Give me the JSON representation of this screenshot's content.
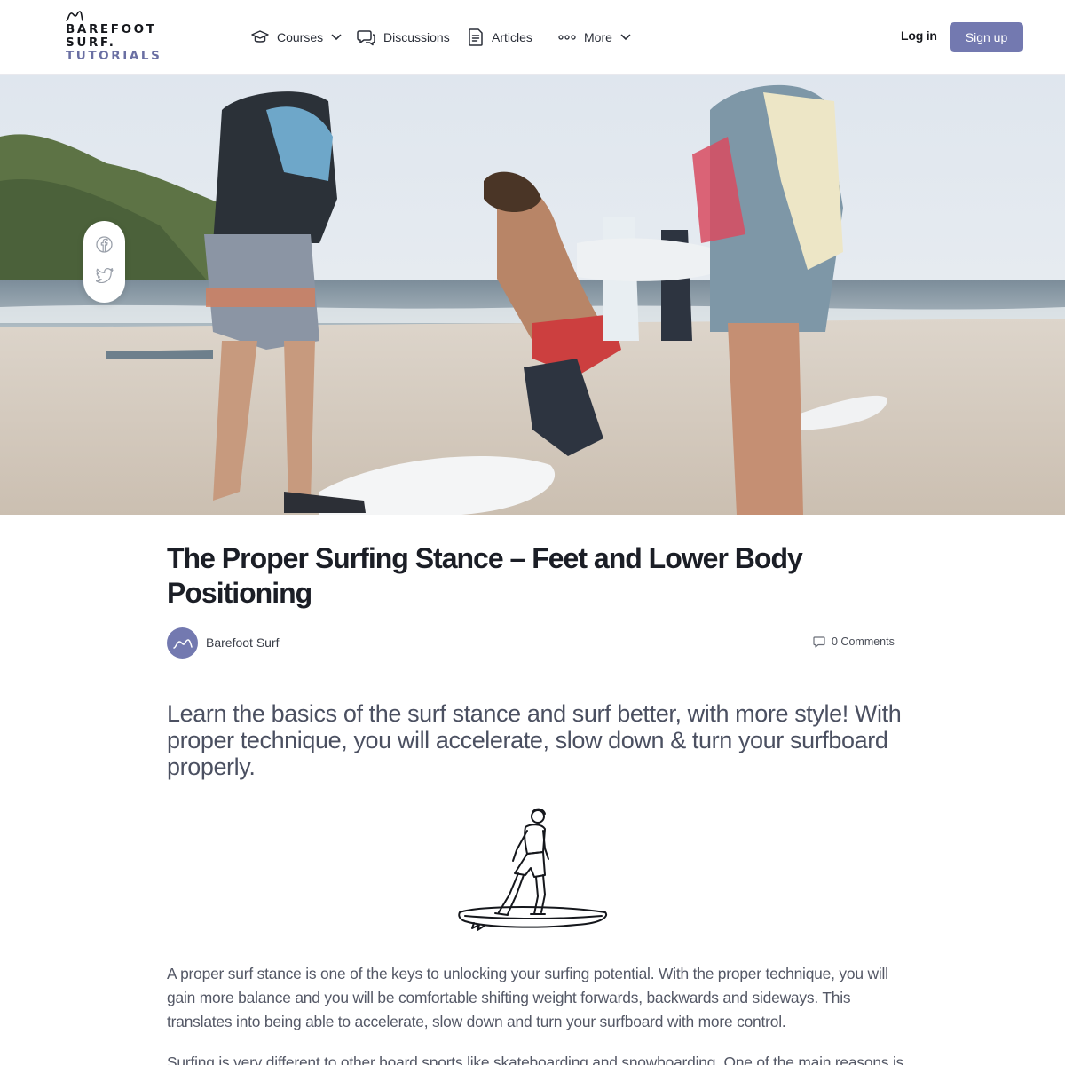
{
  "brand": {
    "line1": "BAREFOOT",
    "line2": "SURF.",
    "line3": "TUTORIALS",
    "accent_color": "#7379b0"
  },
  "nav": {
    "courses": {
      "label": "Courses",
      "icon": "graduation-cap-icon"
    },
    "discussions": {
      "label": "Discussions",
      "icon": "chat-bubbles-icon"
    },
    "articles": {
      "label": "Articles",
      "icon": "document-icon"
    },
    "more": {
      "label": "More",
      "icon": "more-dots-icon"
    }
  },
  "auth": {
    "login_label": "Log in",
    "signup_label": "Sign up"
  },
  "share": {
    "facebook_icon": "facebook-icon",
    "twitter_icon": "twitter-icon"
  },
  "article": {
    "title": "The Proper Surfing Stance – Feet and Lower Body Positioning",
    "author": "Barefoot Surf",
    "comments": "0 Comments",
    "lead": "Learn the basics of the surf stance and surf better, with more style! With proper technique, you will accelerate, slow down & turn your surfboard properly.",
    "paragraph1": "A proper surf stance is one of the keys to unlocking your surfing potential. With the proper technique, you will gain more balance and you will be comfortable shifting weight forwards, backwards and sideways. This translates into being able to accelerate, slow down and turn your surfboard with more control.",
    "paragraph2": "Surfing is very different to other board sports like skateboarding and snowboarding. One of the main reasons is"
  }
}
